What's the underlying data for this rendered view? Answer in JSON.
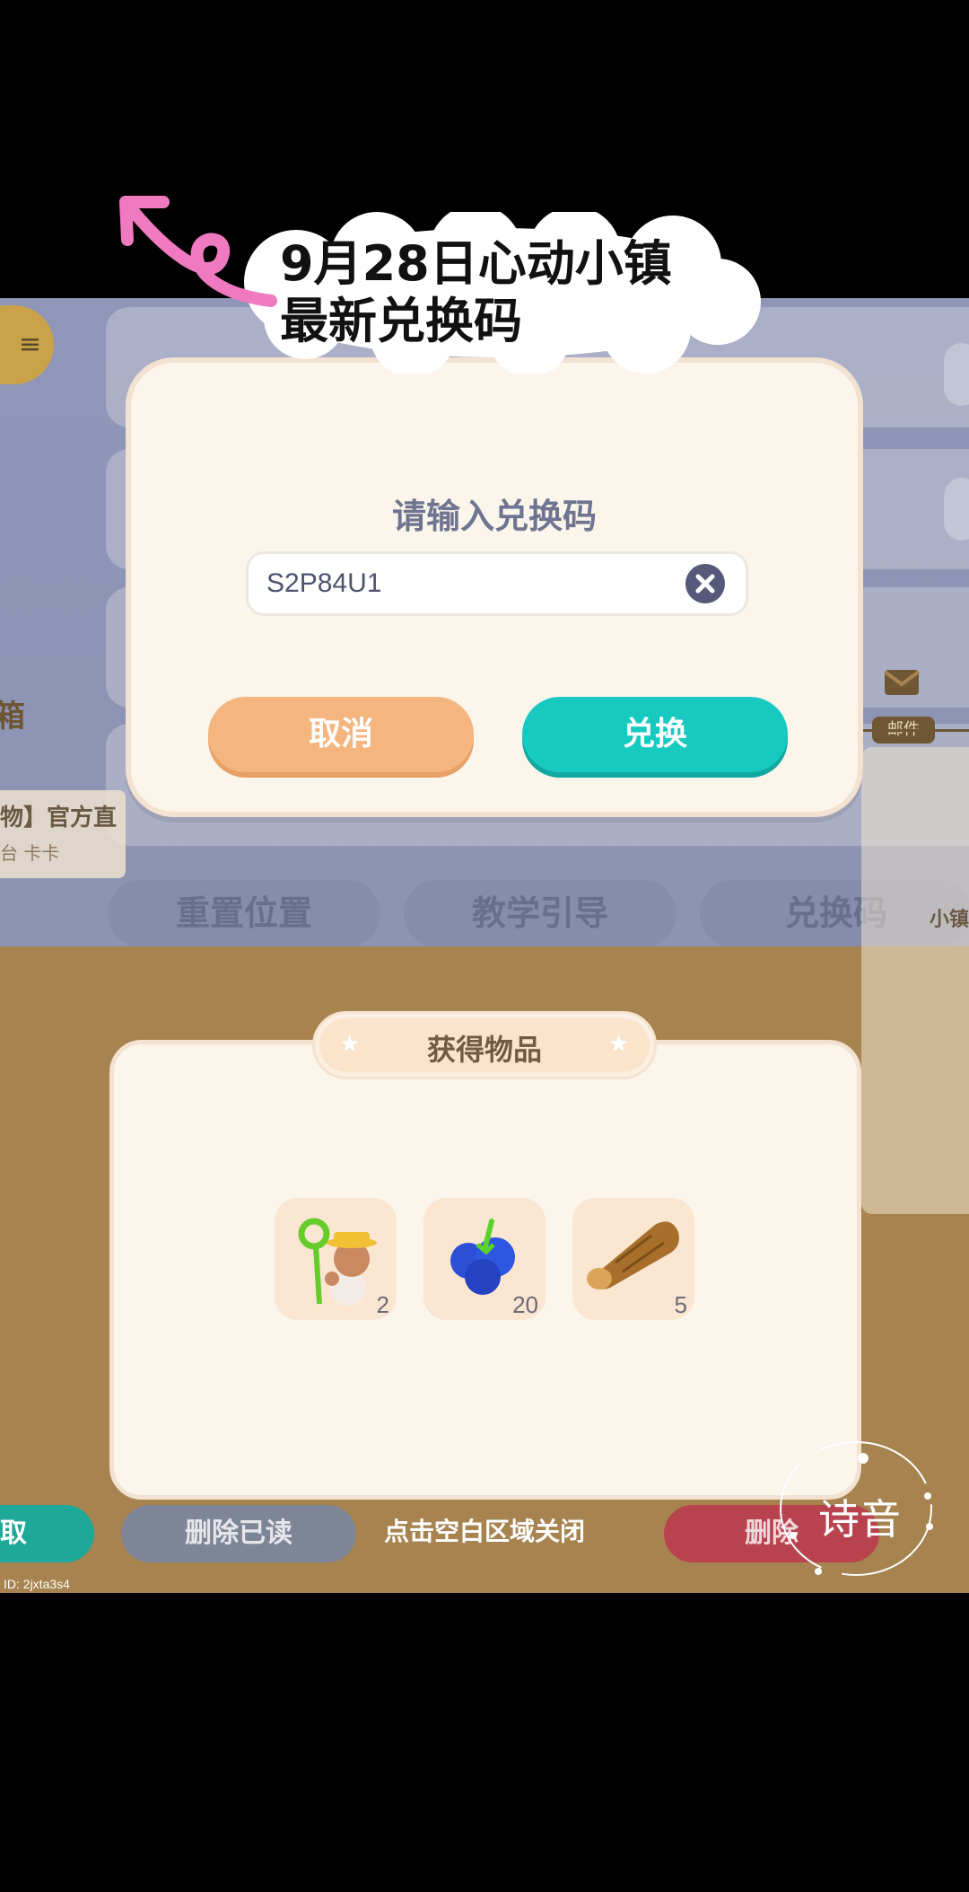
{
  "banner": {
    "line1": "9月28日心动小镇",
    "line2": "最新兑换码"
  },
  "background": {
    "menu_icon": "≡",
    "bottom_pills": [
      "重置位置",
      "教学引导",
      "兑换码"
    ],
    "mail_title": "箱",
    "mail_tab_label": "邮件",
    "mail_item_title": "物】官方直",
    "mail_item_sub": "台 卡卡",
    "mail_right_text": "小镇"
  },
  "redeem_dialog": {
    "title": "请输入兑换码",
    "code_value": "S2P84U1",
    "cancel_label": "取消",
    "redeem_label": "兑换"
  },
  "rewards": {
    "title": "获得物品",
    "items": [
      {
        "icon": "bug-net-character-icon",
        "count": "2"
      },
      {
        "icon": "blueberry-icon",
        "count": "20"
      },
      {
        "icon": "wood-log-icon",
        "count": "5"
      }
    ]
  },
  "bottom_bar": {
    "claim_label": "取",
    "delete_read_label": "删除已读",
    "close_hint": "点击空白区域关闭",
    "delete_label": "删除",
    "id_text": "ID: 2jxta3s4"
  },
  "watermark": "诗音",
  "colors": {
    "redeem_button": "#18c9c0",
    "cancel_button": "#f4b67e",
    "dialog_bg": "#fbf5ec",
    "mail_bg": "#a7834f"
  }
}
